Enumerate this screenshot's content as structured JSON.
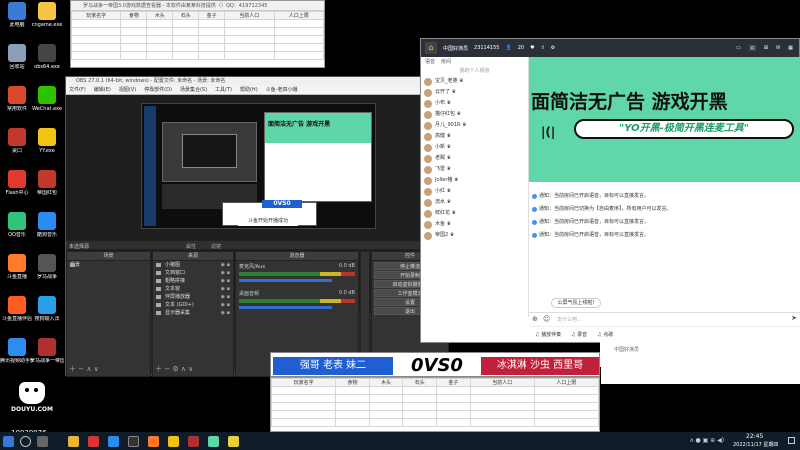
{
  "desktop_icons": [
    {
      "label": "此电脑",
      "color": "#3a7bd5"
    },
    {
      "label": "cngame.exe",
      "color": "#f4c542"
    },
    {
      "label": "回收站",
      "color": "#8aa0b8"
    },
    {
      "label": "obs64.exe",
      "color": "#444"
    },
    {
      "label": "常用软件",
      "color": "#d84a2b"
    },
    {
      "label": "WeChat.exe",
      "color": "#2dc100"
    },
    {
      "label": "桌口",
      "color": "#c0392b"
    },
    {
      "label": "YY.exe",
      "color": "#f1c40f"
    },
    {
      "label": "Flash中心",
      "color": "#e03a2f"
    },
    {
      "label": "帝国红包",
      "color": "#c0392b"
    },
    {
      "label": "QQ音乐",
      "color": "#31c27c"
    },
    {
      "label": "酷狗音乐",
      "color": "#2a8cf0"
    },
    {
      "label": "斗鱼直播",
      "color": "#ff7a2b"
    },
    {
      "label": "罗马战争",
      "color": "#555"
    },
    {
      "label": "斗鱼直播伴侣",
      "color": "#ff5d23"
    },
    {
      "label": "搜狗输入法",
      "color": "#2aa0e8"
    },
    {
      "label": "腾讯视频助手5.0",
      "color": "#2d8cf0"
    },
    {
      "label": "罗马战争一帝国3.0",
      "color": "#b03030"
    }
  ],
  "douyu": {
    "brand": "DOUYU.COM",
    "room_id": "10029976"
  },
  "sheet_top": {
    "title": "罗马战争一帝国3.0游戏数据查看器 - 本软件由某某科技提供（）QQ：419712345",
    "headers": [
      "玩家名字",
      "食物",
      "木头",
      "石头",
      "金子",
      "当前人口",
      "人口上限"
    ]
  },
  "sheet_bottom": {
    "headers": [
      "玩家名字",
      "食物",
      "木头",
      "石头",
      "金子",
      "当前人口",
      "人口上限"
    ]
  },
  "obs": {
    "title": "OBS 27.0.1 (64-bit, windows) - 配置文件: 未命名 - 场景: 未命名",
    "menu": [
      "文件(F)",
      "编辑(E)",
      "视图(V)",
      "停靠部件(D)",
      "场景集合(S)",
      "工具(T)",
      "帮助(H)",
      "斗鱼-老四小蛾"
    ],
    "no_source": "未选择源",
    "props_btn": "属性",
    "filters_btn": "滤镜",
    "scenes_header": "场景",
    "scene_item": "场景",
    "sources_header": "来源",
    "sources": [
      "小猪图",
      "文档窗口",
      "粗略拼接",
      "文本窗",
      "伴屏播放器",
      "文本 (GDI+)",
      "显示器采集"
    ],
    "mixer_header": "混音器",
    "mixer": [
      {
        "name": "麦克风/Aux",
        "db": "0.0 dB"
      },
      {
        "name": "桌面音频",
        "db": "0.0 dB"
      }
    ],
    "transition_header": "转场特效",
    "controls_header": "控件",
    "controls": [
      "停止推流",
      "开始录制",
      "启动虚拟摄像机",
      "工作室模式",
      "设置",
      "退出"
    ],
    "preview_banner": "面简洁无广告 游戏开黑",
    "preview_caption": "斗鱼开始开播成功"
  },
  "room": {
    "name": "中国好演员",
    "id": "23114155",
    "online": "20",
    "tab": "房间",
    "voice_label": "语音",
    "members_hint": "我的个人频道",
    "members": [
      "宝贝_老婆",
      "云开了",
      "小布",
      "猫仔红包",
      "月儿_901R",
      "高健",
      "小新",
      "老贼",
      "飞雷",
      "Joller猪",
      "小红",
      "流水",
      "鲜红花",
      "木鱼",
      "帝国2"
    ],
    "banner_text": "面简洁无广告  游戏开黑",
    "slogan": "\"YO开黑-极简开黑连麦工具\"",
    "chats": [
      "通知：当前房间已开启语音，目标可以直接发言。",
      "通知：当前房间已切换为【自由麦序】，所有用户可以发言。",
      "通知：当前房间已开启语音，目标可以直接发言。",
      "通知：当前房间已开启语音，目标可以直接发言。"
    ],
    "popup": "公屏气氛上线啦!",
    "input_placeholder": "发什么吧...",
    "bottom_items": [
      "播放伴奏",
      "录音",
      "点歌"
    ],
    "right_rooms": [
      "个人空间",
      "中国好演员"
    ]
  },
  "vs_banner": {
    "left": "强哥 老表 妹二",
    "vs": "0VS0",
    "right": "冰淇淋 沙虫 西里哥"
  },
  "clock": {
    "time": "22:45",
    "date": "2022/11/17 星期四"
  },
  "colors": {
    "vs_left": "#1f5fd1",
    "vs_right": "#c2203a",
    "room_accent": "#3bbf8a",
    "taskbar": "#111c2a"
  }
}
